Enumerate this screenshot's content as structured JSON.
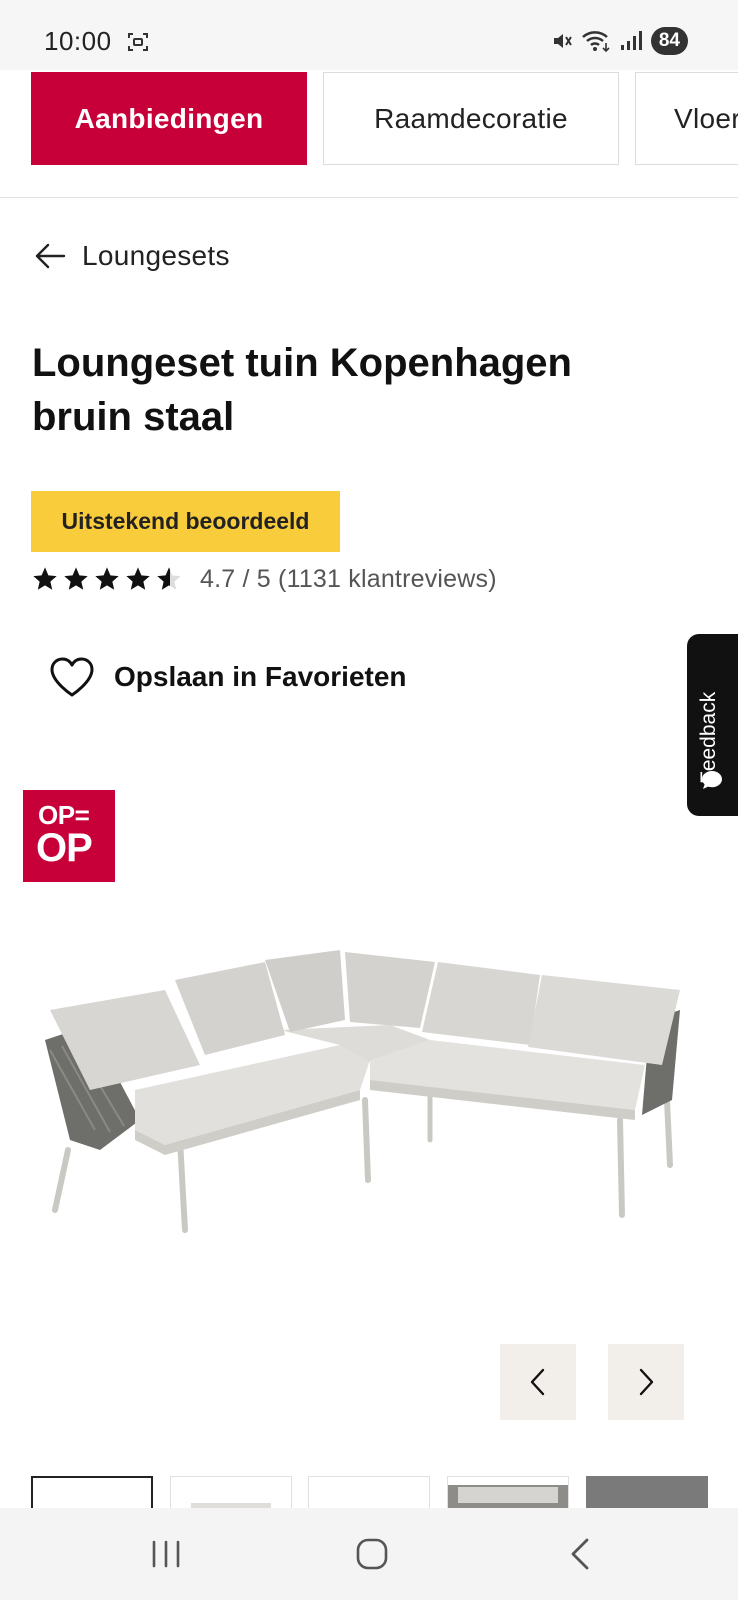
{
  "status_bar": {
    "time": "10:00",
    "battery": "84",
    "icons": [
      "screen-record-icon",
      "mute-icon",
      "wifi-icon",
      "signal-icon"
    ]
  },
  "category_tabs": [
    {
      "label": "Aanbiedingen",
      "active": true
    },
    {
      "label": "Raamdecoratie",
      "active": false
    },
    {
      "label": "Vloer",
      "active": false
    }
  ],
  "breadcrumb": {
    "back_label": "Loungesets"
  },
  "product": {
    "title_line1": "Loungeset tuin Kopenhagen",
    "title_line2": "bruin staal",
    "badge": "Uitstekend beoordeeld",
    "rating": 4.7,
    "rating_text": "4.7 / 5 (1131 klantreviews)",
    "favorite_label": "Opslaan in Favorieten",
    "promo_badge_line1": "OP=",
    "promo_badge_line2": "OP"
  },
  "feedback": {
    "label": "Feedback"
  },
  "colors": {
    "brand": "#c8003a",
    "badge_yellow": "#f9cc3c",
    "carousel_button_bg": "#f2efeb"
  },
  "carousel": {
    "thumbnail_count": 5,
    "selected_index": 0
  },
  "nav_bar": {
    "icons": [
      "recent-apps-icon",
      "home-icon",
      "back-icon"
    ]
  }
}
